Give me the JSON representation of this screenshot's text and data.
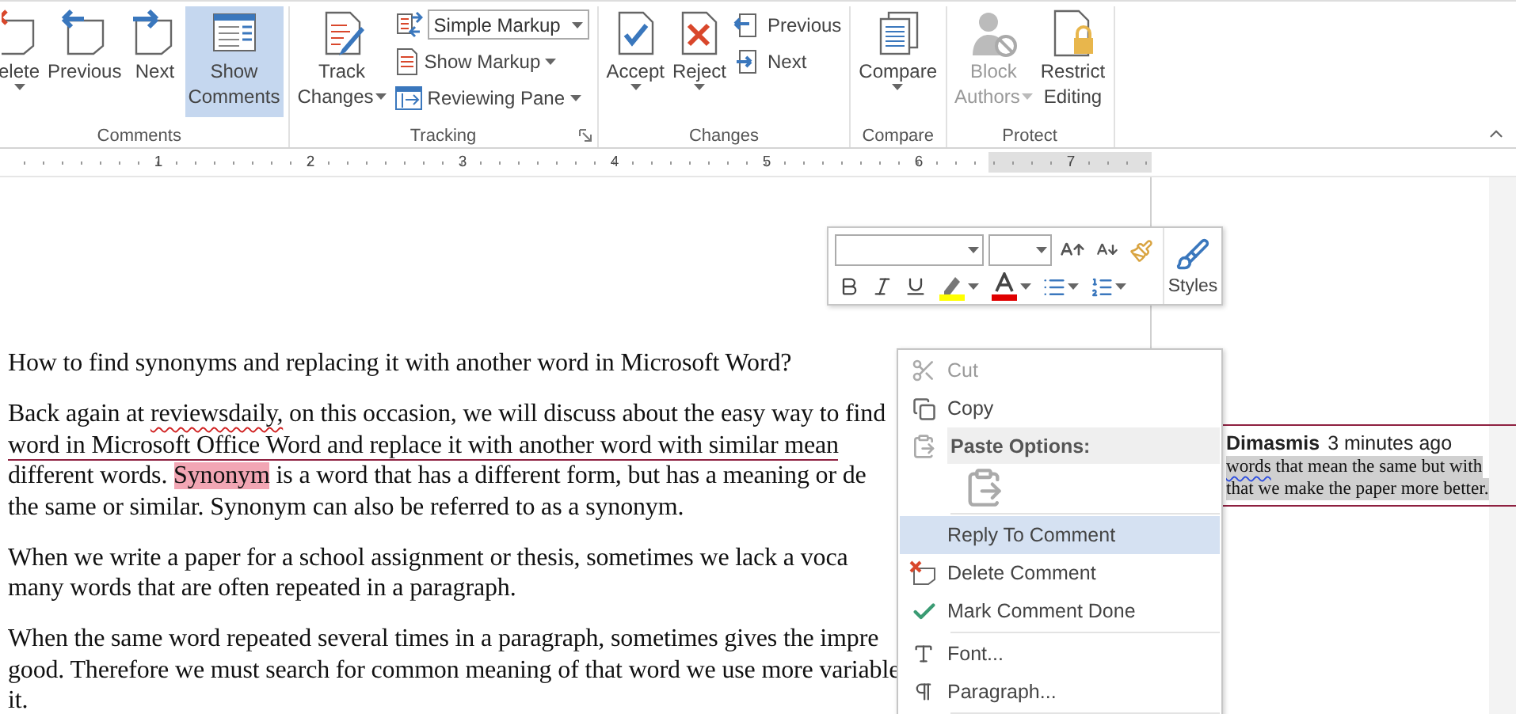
{
  "ribbon": {
    "groups": [
      {
        "label": "Comments",
        "dialog_launcher": false,
        "items": [
          {
            "kind": "large",
            "lines": [
              "elete"
            ],
            "dropdown": true,
            "selected": false,
            "disabled": false
          },
          {
            "kind": "large",
            "lines": [
              "Previous"
            ],
            "dropdown": false,
            "selected": false,
            "disabled": false
          },
          {
            "kind": "large",
            "lines": [
              "Next"
            ],
            "dropdown": false,
            "selected": false,
            "disabled": false
          },
          {
            "kind": "large",
            "lines": [
              "Show",
              "Comments"
            ],
            "dropdown": false,
            "selected": true,
            "disabled": false
          }
        ]
      },
      {
        "label": "Tracking",
        "dialog_launcher": true,
        "items": [
          {
            "kind": "large",
            "lines": [
              "Track",
              "Changes"
            ],
            "dropdown": true,
            "selected": false,
            "disabled": false
          },
          {
            "kind": "stack",
            "items": [
              {
                "kind": "select",
                "value": "Simple Markup"
              },
              {
                "kind": "small",
                "label": "Show Markup",
                "dropdown": true
              },
              {
                "kind": "small",
                "label": "Reviewing Pane",
                "dropdown": true
              }
            ]
          }
        ]
      },
      {
        "label": "Changes",
        "dialog_launcher": false,
        "items": [
          {
            "kind": "large",
            "lines": [
              "Accept"
            ],
            "dropdown": true,
            "selected": false,
            "disabled": false
          },
          {
            "kind": "large",
            "lines": [
              "Reject"
            ],
            "dropdown": true,
            "selected": false,
            "disabled": false
          },
          {
            "kind": "stack",
            "items": [
              {
                "kind": "small",
                "label": "Previous",
                "dropdown": false
              },
              {
                "kind": "small",
                "label": "Next",
                "dropdown": false
              }
            ]
          }
        ]
      },
      {
        "label": "Compare",
        "dialog_launcher": false,
        "items": [
          {
            "kind": "large",
            "lines": [
              "Compare"
            ],
            "dropdown": true,
            "selected": false,
            "disabled": false
          }
        ]
      },
      {
        "label": "Protect",
        "dialog_launcher": false,
        "items": [
          {
            "kind": "large",
            "lines": [
              "Block",
              "Authors"
            ],
            "dropdown": true,
            "selected": false,
            "disabled": true
          },
          {
            "kind": "large",
            "lines": [
              "Restrict",
              "Editing"
            ],
            "dropdown": false,
            "selected": false,
            "disabled": false
          }
        ]
      }
    ]
  },
  "ruler": {
    "numbers": [
      "1",
      "2",
      "3",
      "4",
      "5",
      "6",
      "7"
    ]
  },
  "document": {
    "paragraphs": [
      {
        "lines": [
          {
            "segments": [
              {
                "kind": "plain",
                "text": "How to find synonyms and replacing it with another word in Microsoft Word?"
              }
            ]
          }
        ]
      },
      {
        "lines": [
          {
            "segments": [
              {
                "kind": "plain",
                "text": "Back again at "
              },
              {
                "kind": "spelling",
                "text": "reviewsdaily,"
              },
              {
                "kind": "plain",
                "text": " on this occasion, we will discuss about the easy way to find"
              }
            ]
          },
          {
            "segments": [
              {
                "kind": "comment_anchor",
                "text": "word in Microsoft Office Word and replace it with another word with similar mean"
              }
            ]
          },
          {
            "segments": [
              {
                "kind": "plain",
                "text": "different words. "
              },
              {
                "kind": "highlight",
                "text": "Synonym"
              },
              {
                "kind": "plain",
                "text": " is a word that has a different form, but has a meaning or de"
              }
            ]
          },
          {
            "segments": [
              {
                "kind": "plain",
                "text": "the same or similar. Synonym can also be referred to as a synonym."
              }
            ]
          }
        ]
      },
      {
        "lines": [
          {
            "segments": [
              {
                "kind": "plain",
                "text": "When we write a paper for a school assignment or thesis, sometimes we lack a voca"
              }
            ]
          },
          {
            "segments": [
              {
                "kind": "plain",
                "text": "many words that are often repeated in a paragraph."
              }
            ]
          }
        ]
      },
      {
        "lines": [
          {
            "segments": [
              {
                "kind": "plain",
                "text": "When the same word repeated several times in a paragraph, sometimes gives the impre"
              }
            ]
          },
          {
            "segments": [
              {
                "kind": "plain",
                "text": "good. Therefore we must search for common meaning of that word we use more variable"
              }
            ]
          },
          {
            "segments": [
              {
                "kind": "plain",
                "text": "it."
              }
            ]
          }
        ]
      }
    ]
  },
  "comment": {
    "author": "Dimasmis",
    "time": "3 minutes ago",
    "lines": [
      {
        "segments": [
          {
            "kind": "grammar",
            "text": "words"
          },
          {
            "kind": "plain",
            "text": " that mean the same but with"
          }
        ]
      },
      {
        "segments": [
          {
            "kind": "plain",
            "text": "that we make the paper more better."
          }
        ]
      }
    ]
  },
  "mini_toolbar": {
    "styles_label": "Styles"
  },
  "context_menu": {
    "items": [
      {
        "kind": "item",
        "label": "Cut",
        "disabled": true,
        "selected": false
      },
      {
        "kind": "item",
        "label": "Copy",
        "disabled": false,
        "selected": false
      },
      {
        "kind": "header",
        "label": "Paste Options:"
      },
      {
        "kind": "paste_row"
      },
      {
        "kind": "separator"
      },
      {
        "kind": "item",
        "label": "Reply To Comment",
        "disabled": false,
        "selected": true
      },
      {
        "kind": "item",
        "label": "Delete Comment",
        "disabled": false,
        "selected": false
      },
      {
        "kind": "item",
        "label": "Mark Comment Done",
        "disabled": false,
        "selected": false
      },
      {
        "kind": "separator"
      },
      {
        "kind": "item",
        "label": "Font...",
        "disabled": false,
        "selected": false
      },
      {
        "kind": "item",
        "label": "Paragraph...",
        "disabled": false,
        "selected": false
      },
      {
        "kind": "separator"
      }
    ]
  }
}
